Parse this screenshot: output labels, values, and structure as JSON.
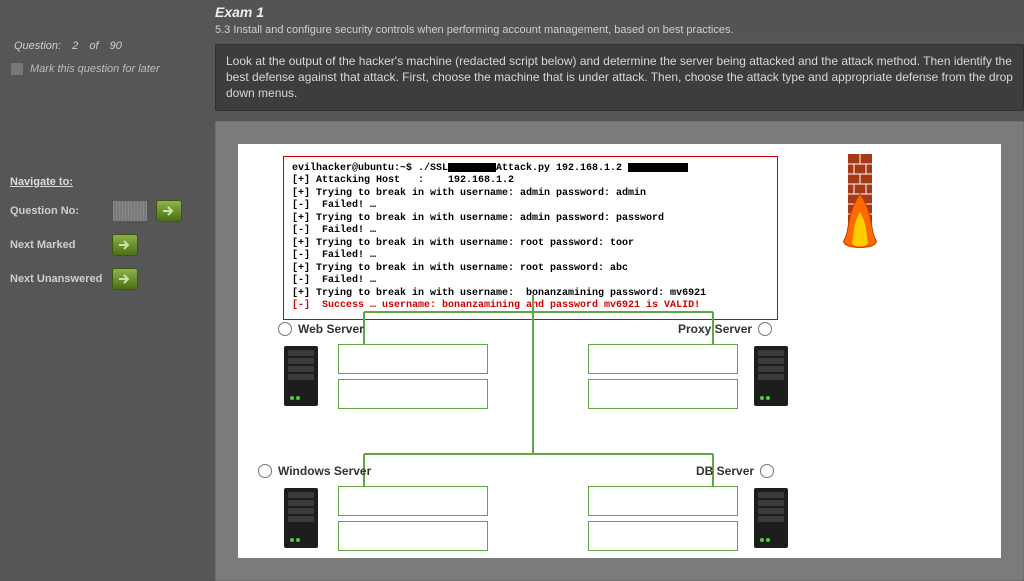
{
  "leftPanel": {
    "questionWord": "Question:",
    "current": "2",
    "of": "of",
    "total": "90",
    "markLabel": "Mark this question for later",
    "navTitle": "Navigate to:",
    "qNoLabel": "Question No:",
    "nextMarked": "Next Marked",
    "nextUnanswered": "Next Unanswered"
  },
  "header": {
    "title": "Exam 1",
    "subtitle": "5.3 Install and configure security controls when performing account management, based on best practices."
  },
  "instructions": "Look at the output of the hacker's machine (redacted script below) and determine the server being attacked and the attack method. Then identify the best defense against that attack. First, choose the machine that is under attack. Then, choose the attack type and appropriate defense from the drop down menus.",
  "terminal": {
    "l1a": "evilhacker@ubuntu:~$ ./SSL",
    "l1b": "Attack.py 192.168.1.2 ",
    "l2": "[+] Attacking Host   :    192.168.1.2",
    "l3": "[+] Trying to break in with username: admin password: admin",
    "l4": "[-]  Failed! …",
    "l5": "[+] Trying to break in with username: admin password: password",
    "l6": "[-]  Failed! …",
    "l7": "[+] Trying to break in with username: root password: toor",
    "l8": "[-]  Failed! …",
    "l9": "[+] Trying to break in with username: root password: abc",
    "l10": "[-]  Failed! …",
    "l11": "[+] Trying to break in with username:  bonanzamining password: mv6921",
    "l12": "[-]  Success … username: bonanzamining and password mv6921 is VALID!"
  },
  "servers": {
    "web": "Web Server",
    "proxy": "Proxy Server",
    "windows": "Windows Server",
    "db": "DB Server"
  }
}
